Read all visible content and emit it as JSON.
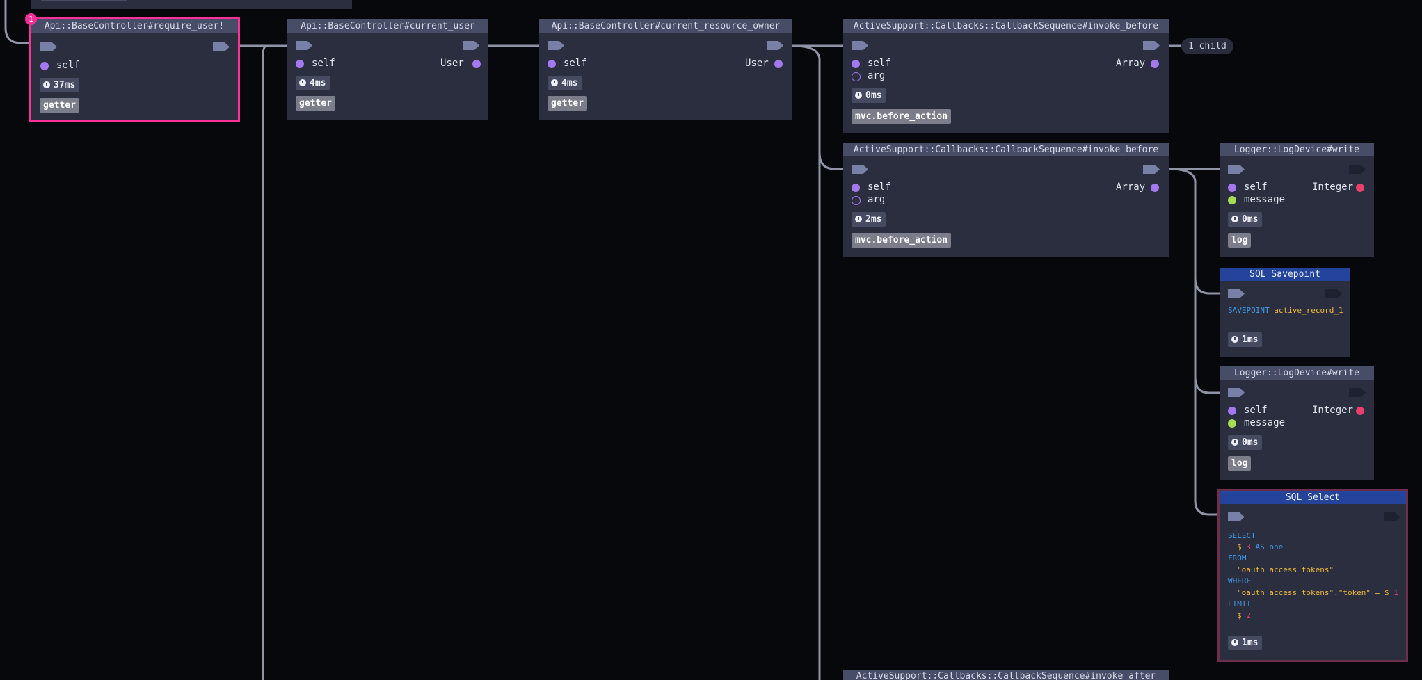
{
  "colors": {
    "background": "#07080b",
    "node_bg": "#2a2e3e",
    "header_bg": "#474d66",
    "sql_header_bg": "#23449a",
    "selection": "#ff2f98",
    "self_dot": "#a678f0",
    "message_dot": "#a6dc52",
    "integer_dot": "#e8406a"
  },
  "icons": [
    "clock-icon",
    "port-flag-icon"
  ],
  "nodes": {
    "require_user": {
      "title": "Api::BaseController#require_user!",
      "badge": "1",
      "param": "self",
      "time": "37ms",
      "label": "getter"
    },
    "current_user": {
      "title": "Api::BaseController#current_user",
      "param": "self",
      "return_type": "User",
      "time": "4ms",
      "label": "getter"
    },
    "current_resource_owner": {
      "title": "Api::BaseController#current_resource_owner",
      "param": "self",
      "return_type": "User",
      "time": "4ms",
      "label": "getter"
    },
    "invoke_before_1": {
      "title": "ActiveSupport::Callbacks::CallbackSequence#invoke_before",
      "param": "self",
      "param2": "arg",
      "return_type": "Array",
      "time": "0ms",
      "label": "mvc.before_action",
      "children_chip": "1 child"
    },
    "invoke_before_2": {
      "title": "ActiveSupport::Callbacks::CallbackSequence#invoke_before",
      "param": "self",
      "param2": "arg",
      "return_type": "Array",
      "time": "2ms",
      "label": "mvc.before_action"
    },
    "logdevice_1": {
      "title": "Logger::LogDevice#write",
      "param": "self",
      "param2": "message",
      "return_type": "Integer",
      "time": "0ms",
      "label": "log"
    },
    "sql_savepoint": {
      "title": "SQL Savepoint",
      "keyword": "SAVEPOINT",
      "target": "active_record_1",
      "time": "1ms"
    },
    "logdevice_2": {
      "title": "Logger::LogDevice#write",
      "param": "self",
      "param2": "message",
      "return_type": "Integer",
      "time": "0ms",
      "label": "log"
    },
    "sql_select": {
      "title": "SQL Select",
      "l1": "SELECT",
      "l2_pre": "$ ",
      "l2_num": "3",
      "l2_post": " AS one",
      "l3": "FROM",
      "l4": "\"oauth_access_tokens\"",
      "l5": "WHERE",
      "l6_str": "\"oauth_access_tokens\".\"token\" = $ ",
      "l6_num": "1",
      "l7": "LIMIT",
      "l8_pre": "$ ",
      "l8_num": "2",
      "time": "1ms"
    },
    "invoke_after": {
      "title": "ActiveSupport::Callbacks::CallbackSequence#invoke_after"
    }
  }
}
